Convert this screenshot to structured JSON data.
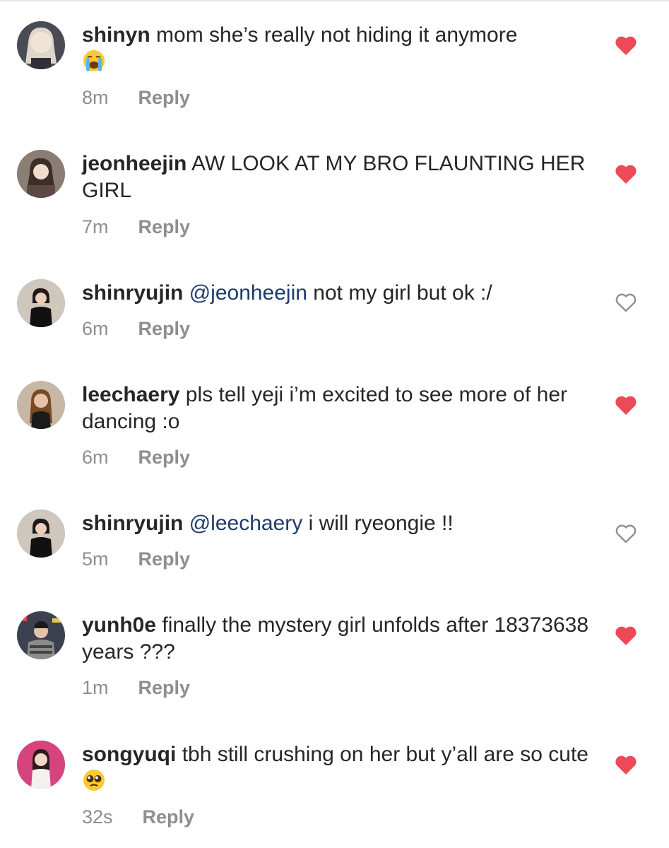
{
  "comments": [
    {
      "username": "shinyn",
      "text": "mom she’s really not hiding it anymore",
      "mention": "",
      "emoji": "loudly-crying-face",
      "time": "8m",
      "reply": "Reply",
      "liked": true,
      "avatar_color": "#cfc7bd"
    },
    {
      "username": "jeonheejin",
      "text": "AW LOOK AT MY BRO FLAUNTING HER GIRL",
      "mention": "",
      "emoji": "",
      "time": "7m",
      "reply": "Reply",
      "liked": true,
      "avatar_color": "#b79c8c"
    },
    {
      "username": "shinryujin",
      "text": "not my girl but ok :/",
      "mention": "@jeonheejin",
      "emoji": "",
      "time": "6m",
      "reply": "Reply",
      "liked": false,
      "avatar_color": "#b0a399"
    },
    {
      "username": "leechaery",
      "text": "pls tell yeji i’m excited to see more of her dancing :o",
      "mention": "",
      "emoji": "",
      "time": "6m",
      "reply": "Reply",
      "liked": true,
      "avatar_color": "#a07a5c"
    },
    {
      "username": "shinryujin",
      "text": "i will ryeongie !!",
      "mention": "@leechaery",
      "emoji": "",
      "time": "5m",
      "reply": "Reply",
      "liked": false,
      "avatar_color": "#b0a399"
    },
    {
      "username": "yunh0e",
      "text": "finally the mystery girl unfolds after 18373638 years ???",
      "mention": "",
      "emoji": "",
      "time": "1m",
      "reply": "Reply",
      "liked": true,
      "avatar_color": "#6a6f80"
    },
    {
      "username": "songyuqi",
      "text": "tbh still crushing on her but y’all are so cute",
      "mention": "",
      "emoji": "pleading-face",
      "time": "32s",
      "reply": "Reply",
      "liked": true,
      "avatar_color": "#c8417a"
    }
  ],
  "colors": {
    "heart_filled": "#ed4956",
    "heart_outline": "#8e8e8e",
    "mention": "#1f3a6d",
    "meta": "#8e8e8e"
  }
}
